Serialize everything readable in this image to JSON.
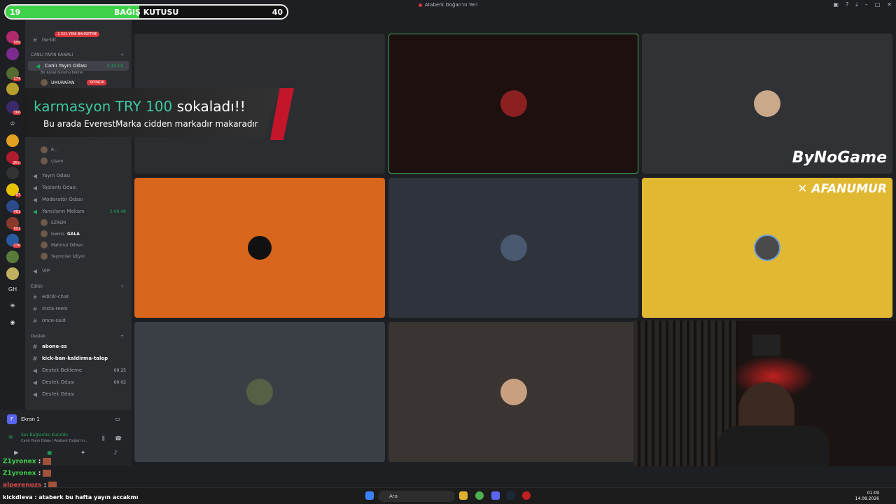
{
  "window": {
    "title": "Ataberk Doğan'ın Yeri"
  },
  "donation": {
    "left": "19",
    "label": "BAĞIŞ KUTUSU",
    "right": "40",
    "progress": 0.475,
    "fill_color": "#3fd14a"
  },
  "alert": {
    "user": "karmasyon",
    "amount": "TRY 100",
    "action": "sokaladı!!",
    "message": "Bu arada EverestMarka cidden markadır makaradır"
  },
  "sidebar": {
    "top_channel": "tw-bit",
    "promo_pill": "2.321 YENİ BAHSETME",
    "category_live": "CANLI YAYIN KANALI",
    "live_room": {
      "label": "Canlı Yayın Odası",
      "time": "0:10:03",
      "sub": "Bir kanal durumu belirle"
    },
    "live_user": {
      "name": "UMURAFAN",
      "badge": "YAYINDA"
    },
    "users_a": [
      "R...",
      "çisem"
    ],
    "voice": [
      {
        "label": "Yayın Odası"
      },
      {
        "label": "Toplantı Odası"
      },
      {
        "label": "Moderatör Odası"
      },
      {
        "label": "Yancıların Mekanı",
        "time": "2:06:48"
      }
    ],
    "users_b": [
      "EZREM",
      "lewins",
      "Mahmut Dilben",
      "Yaymcılar İzliyor"
    ],
    "gala": "GALA",
    "vip": "VIP",
    "category_editor": "Editör",
    "editor_channels": [
      "editör-chat",
      "insta-reels",
      "once-said"
    ],
    "category_support": "Destek",
    "support_channels": [
      "abone-ss",
      "kick-ban-kaldirma-talep"
    ],
    "support_voice": [
      {
        "label": "Destek Bekleme",
        "a": "00",
        "b": "25"
      },
      {
        "label": "Destek Odası",
        "a": "00",
        "b": "02"
      },
      {
        "label": "Destek Odası"
      }
    ]
  },
  "rail": {
    "gh_label": "GH",
    "badges": [
      "999",
      "174",
      "366",
      "2K+",
      "97",
      "461",
      "991",
      "236"
    ]
  },
  "user_panel": {
    "name": "Ekran 1",
    "connection": "Ses Bağlantısı Kuruldu",
    "channel": "Canlı Yayın Odası / Ataberk Doğan'ın..."
  },
  "tiles": [
    {
      "color": "#2b2d31"
    },
    {
      "color": "#1f1010",
      "selected": true
    },
    {
      "color": "#313236",
      "sponsor": "ByNoGame"
    },
    {
      "color": "#d8661c"
    },
    {
      "color": "#2f333b"
    },
    {
      "color": "#e0b832",
      "sponsor": "AFANUMUR"
    },
    {
      "color": "#3a3f45"
    },
    {
      "color": "#3a3532"
    }
  ],
  "chat": [
    {
      "user": "Z1yronex",
      "msg": " :"
    },
    {
      "user": "Z1yronex",
      "msg": " :"
    },
    {
      "user": "alperenozs",
      "msg": " :",
      "red": true
    },
    {
      "user": "kickdleva",
      "msg": " : ataberk bu hafta yayın accakmı"
    }
  ],
  "taskbar": {
    "search": "Ara",
    "time": "01:09",
    "date": "14.08.2026"
  }
}
